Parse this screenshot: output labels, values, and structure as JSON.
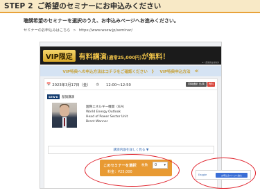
{
  "header": {
    "step_label": "STEP 2",
    "title": "ご希望のセミナーにお申込みください"
  },
  "instruction": "聴講希望のセミナーを選択のうえ、お申込みページへお進みください。",
  "url_line": {
    "from": "セミナーのお申込みはこちら",
    "arrow": ">",
    "url": "https://www.wsew.jp/seminar/"
  },
  "vip_banner": {
    "badge": "VIP限定",
    "headline": "有料講演",
    "price_note": "(通常25,000円)",
    "suffix": "が無料！",
    "caveat": "※一部講演は対象外"
  },
  "vip_strip": {
    "left": "VIP特典への申込方法はコチラをご確認ください",
    "separator": "》",
    "right": "VIP特典申込方法",
    "end": "≪"
  },
  "seminar": {
    "date": "2023年3月17日（金）",
    "time": "12:00～12:50",
    "badge_sync": "同時通訳 日/英",
    "badge_paid": "有料",
    "brand_logo": "SEW-K",
    "brand_name": "基調講演",
    "speaker_lines": [
      "国際エネルギー機関（IEA）",
      "World Energy Outlook",
      "Head of Power Sector Unit",
      "Brent Wanner"
    ],
    "details_link": "講演内容を詳しく見る ▼",
    "select_label": "このセミナーを選択",
    "price": "料金：¥25,000",
    "qty_label": "枚数",
    "qty_value": "0"
  },
  "mini_panel": {
    "label": "Eaggle",
    "button": "お申込みページへ進む"
  },
  "colors": {
    "header_bg": "#f8e9c6",
    "header_border": "#e8a23a",
    "banner_gold": "#f3c64a",
    "select_orange": "#e89a33",
    "highlight_red": "#e0202a",
    "link_blue": "#3a6db3"
  }
}
